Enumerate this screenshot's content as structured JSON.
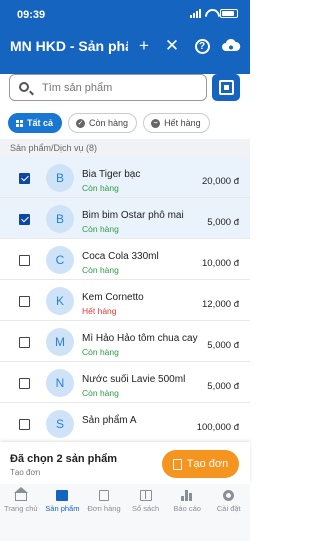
{
  "status_bar": {
    "time": "09:39"
  },
  "header": {
    "title": "MN HKD - Sản phẩm"
  },
  "search": {
    "placeholder": "Tìm sản phẩm"
  },
  "filters": [
    {
      "label": "Tất cả",
      "active": true
    },
    {
      "label": "Còn hàng",
      "active": false
    },
    {
      "label": "Hết hàng",
      "active": false
    }
  ],
  "section": {
    "label": "Sản phẩm/Dịch vụ (8)"
  },
  "products": [
    {
      "initial": "B",
      "name": "Bia Tiger bạc",
      "status": "Còn hàng",
      "in_stock": true,
      "price": "20,000 đ",
      "selected": true
    },
    {
      "initial": "B",
      "name": "Bim bim Ostar phô mai",
      "status": "Còn hàng",
      "in_stock": true,
      "price": "5,000 đ",
      "selected": true
    },
    {
      "initial": "C",
      "name": "Coca Cola 330ml",
      "status": "Còn hàng",
      "in_stock": true,
      "price": "10,000 đ",
      "selected": false
    },
    {
      "initial": "K",
      "name": "Kem Cornetto",
      "status": "Hết hàng",
      "in_stock": false,
      "price": "12,000 đ",
      "selected": false
    },
    {
      "initial": "M",
      "name": "Mì Hảo Hảo tôm chua cay",
      "status": "Còn hàng",
      "in_stock": true,
      "price": "5,000 đ",
      "selected": false
    },
    {
      "initial": "N",
      "name": "Nước suối Lavie 500ml",
      "status": "Còn hàng",
      "in_stock": true,
      "price": "5,000 đ",
      "selected": false
    },
    {
      "initial": "S",
      "name": "Sản phẩm A",
      "status": "",
      "in_stock": true,
      "price": "100,000 đ",
      "selected": false
    }
  ],
  "selection_bar": {
    "text": "Đã chọn 2 sản phẩm",
    "subtext": "Tạo đơn",
    "button": "Tạo đơn"
  },
  "bottom_nav": [
    {
      "label": "Trang chủ",
      "icon": "home-icon",
      "active": false
    },
    {
      "label": "Sản phẩm",
      "icon": "box-icon",
      "active": true
    },
    {
      "label": "Đơn hàng",
      "icon": "document-icon",
      "active": false
    },
    {
      "label": "Sổ sách",
      "icon": "book-icon",
      "active": false
    },
    {
      "label": "Báo cáo",
      "icon": "chart-icon",
      "active": false
    },
    {
      "label": "Cài đặt",
      "icon": "gear-icon",
      "active": false
    }
  ],
  "colors": {
    "primary": "#1565c0",
    "accent": "#f5941e",
    "in_stock": "#2e9a44",
    "out_of_stock": "#e53935"
  }
}
